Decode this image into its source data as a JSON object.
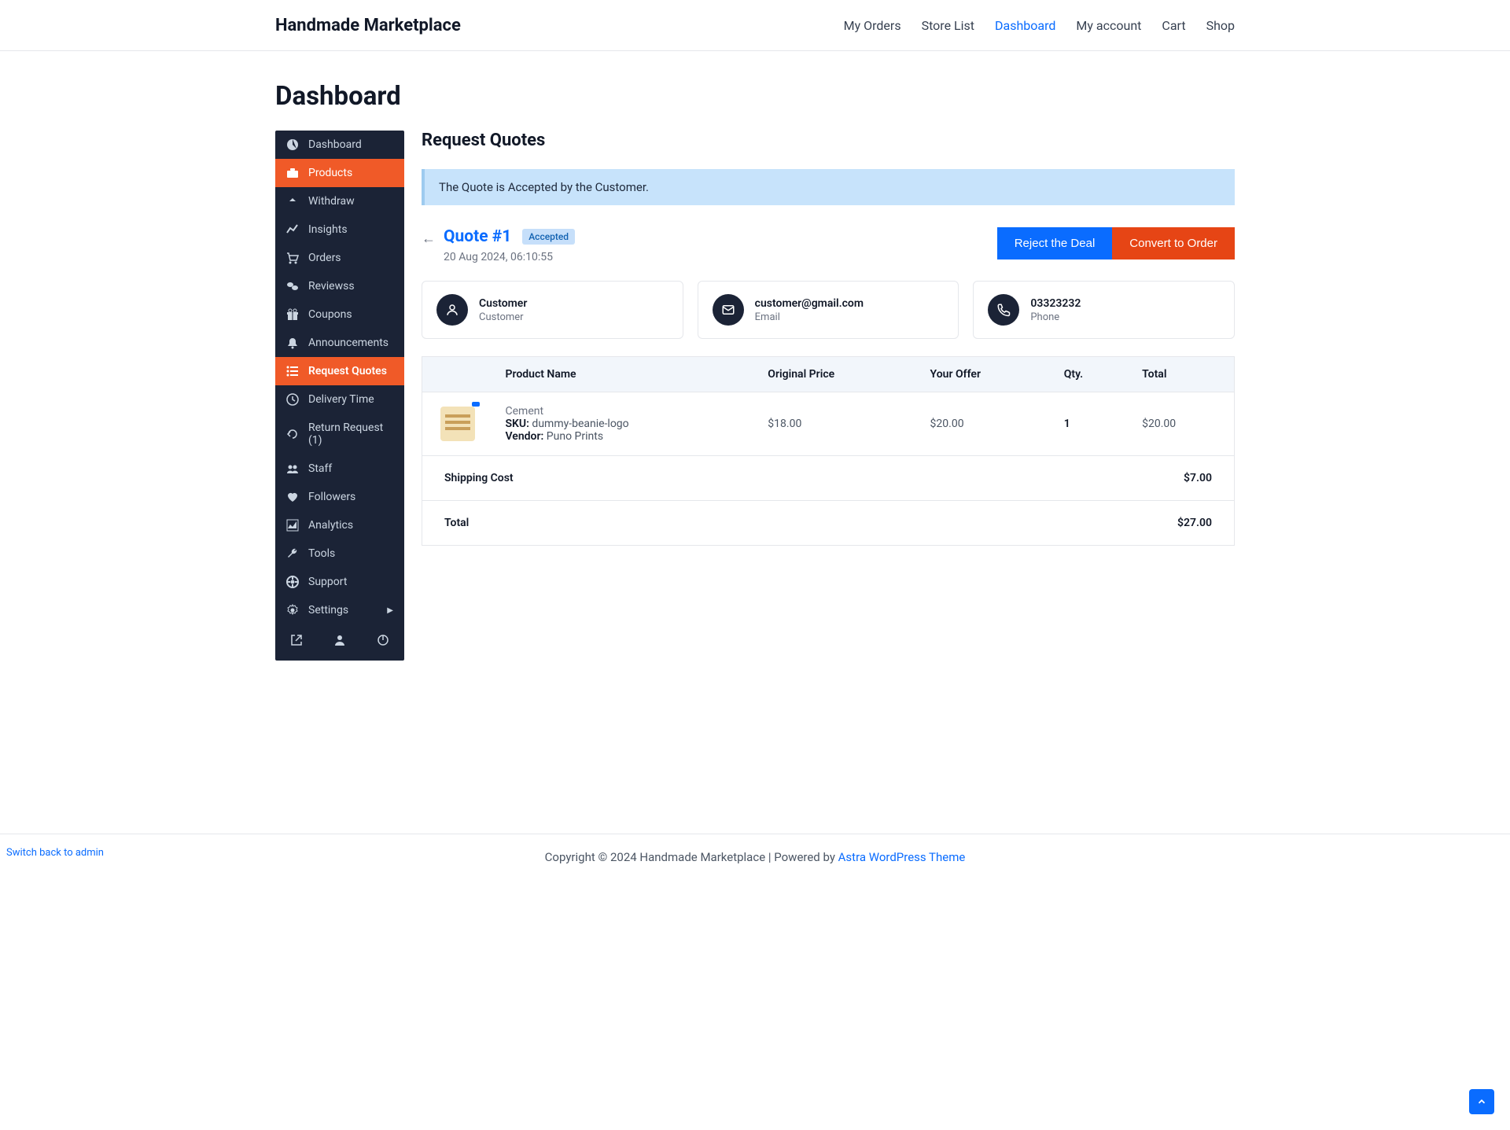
{
  "brand": "Handmade Marketplace",
  "topnav": [
    "My Orders",
    "Store List",
    "Dashboard",
    "My account",
    "Cart",
    "Shop"
  ],
  "topnav_active": 2,
  "page_title": "Dashboard",
  "sidebar": [
    {
      "icon": "dashboard",
      "label": "Dashboard"
    },
    {
      "icon": "briefcase",
      "label": "Products",
      "orange": true
    },
    {
      "icon": "withdraw",
      "label": "Withdraw"
    },
    {
      "icon": "chart",
      "label": "Insights"
    },
    {
      "icon": "cart",
      "label": "Orders"
    },
    {
      "icon": "comments",
      "label": " Reviewss"
    },
    {
      "icon": "gift",
      "label": "Coupons"
    },
    {
      "icon": "bell",
      "label": "Announcements"
    },
    {
      "icon": "list",
      "label": "Request Quotes",
      "active": true
    },
    {
      "icon": "clock",
      "label": "Delivery Time"
    },
    {
      "icon": "undo",
      "label": "Return Request (1)"
    },
    {
      "icon": "users",
      "label": " Staff"
    },
    {
      "icon": "heart",
      "label": "Followers"
    },
    {
      "icon": "area",
      "label": "Analytics"
    },
    {
      "icon": "wrench",
      "label": "Tools"
    },
    {
      "icon": "support",
      "label": "Support"
    },
    {
      "icon": "gear",
      "label": "Settings",
      "chev": true
    }
  ],
  "main_title": "Request Quotes",
  "notice": "The Quote is Accepted by the Customer.",
  "quote": {
    "title": "Quote #1",
    "status": "Accepted",
    "date": "20 Aug 2024, 06:10:55"
  },
  "actions": {
    "reject": "Reject the Deal",
    "convert": "Convert to Order"
  },
  "cards": [
    {
      "icon": "user",
      "primary": "Customer",
      "secondary": "Customer"
    },
    {
      "icon": "mail",
      "primary": "customer@gmail.com",
      "secondary": "Email"
    },
    {
      "icon": "phone",
      "primary": "03323232",
      "secondary": "Phone"
    }
  ],
  "headers": [
    "",
    "Product Name",
    "Original Price",
    "Your Offer",
    "Qty.",
    "Total"
  ],
  "row": {
    "name": "Cement",
    "sku_lbl": "SKU:",
    "sku": "dummy-beanie-logo",
    "vendor_lbl": "Vendor:",
    "vendor": "Puno Prints",
    "original": "$18.00",
    "offer": "$20.00",
    "qty": "1",
    "total": "$20.00"
  },
  "summary": {
    "ship_lbl": "Shipping Cost",
    "ship_val": "$7.00",
    "total_lbl": "Total",
    "total_val": "$27.00"
  },
  "switch_link": "Switch back to admin",
  "footer": {
    "text": "Copyright © 2024 Handmade Marketplace | Powered by ",
    "link": "Astra WordPress Theme"
  }
}
